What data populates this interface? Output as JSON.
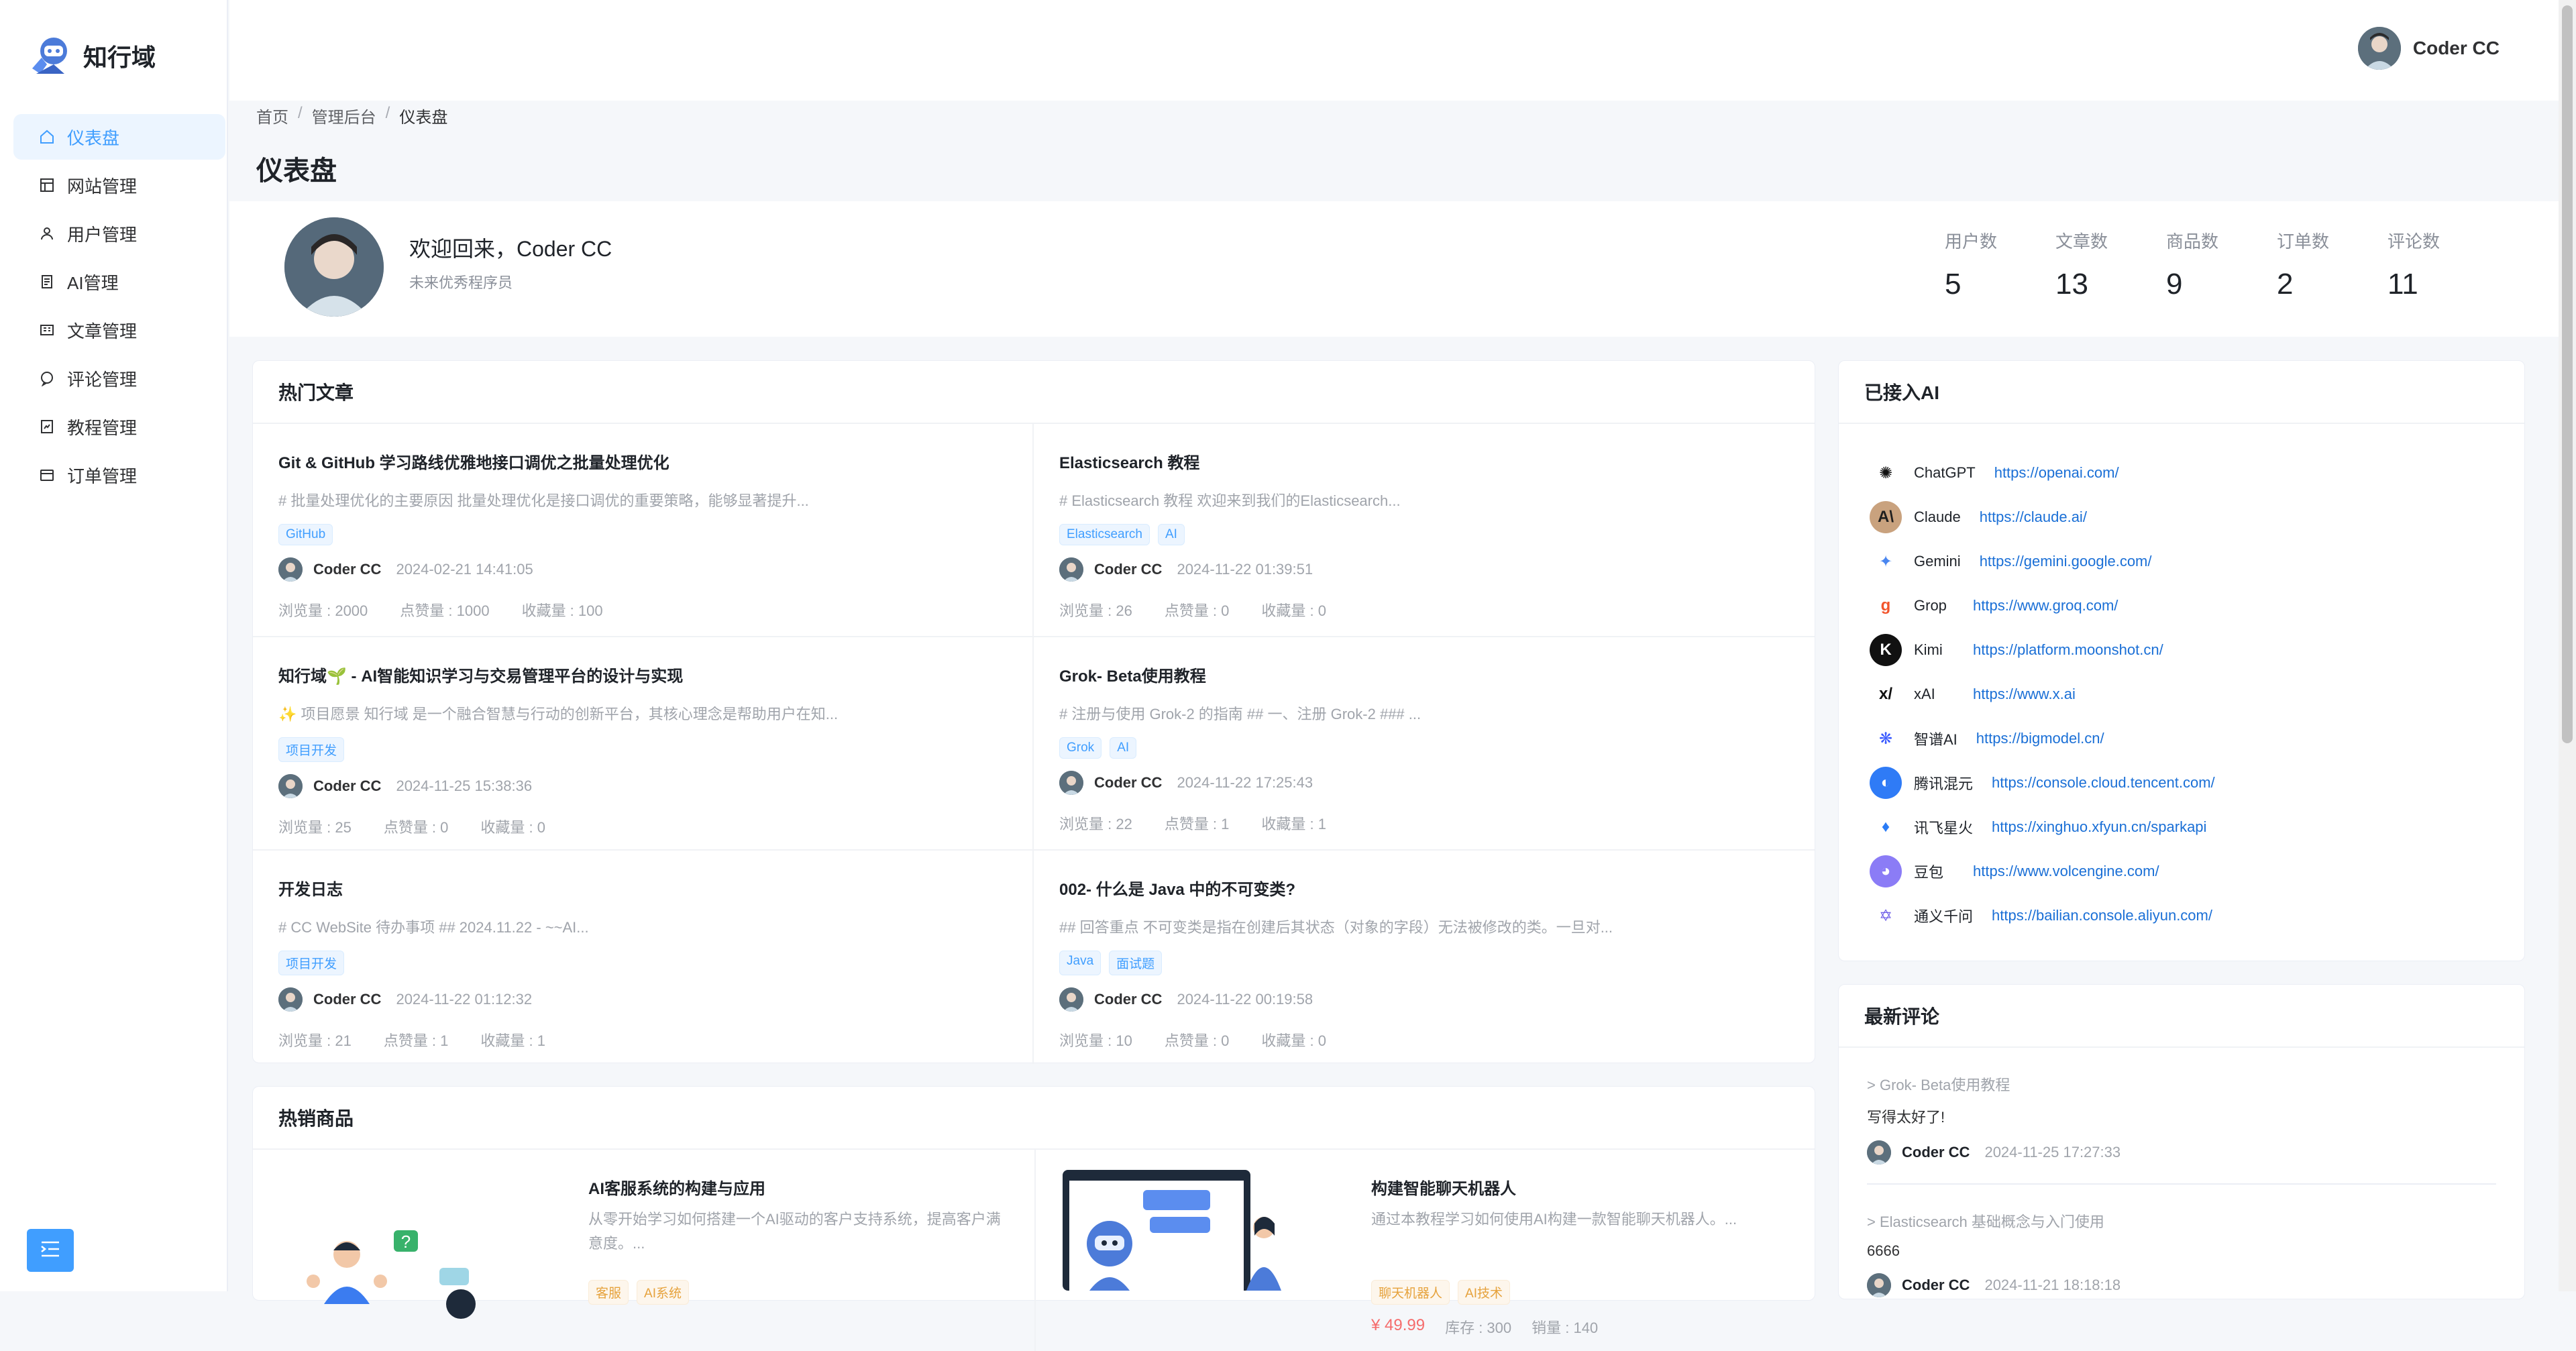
{
  "app": {
    "name": "知行域"
  },
  "sidebar": {
    "items": [
      {
        "label": "仪表盘",
        "icon": "home-icon",
        "active": true
      },
      {
        "label": "网站管理",
        "icon": "grid-icon"
      },
      {
        "label": "用户管理",
        "icon": "user-icon"
      },
      {
        "label": "AI管理",
        "icon": "document-icon"
      },
      {
        "label": "文章管理",
        "icon": "book-icon"
      },
      {
        "label": "评论管理",
        "icon": "chat-icon"
      },
      {
        "label": "教程管理",
        "icon": "tutorial-icon"
      },
      {
        "label": "订单管理",
        "icon": "order-icon"
      }
    ]
  },
  "header": {
    "user_name": "Coder CC"
  },
  "breadcrumb": {
    "items": [
      "首页",
      "管理后台",
      "仪表盘"
    ]
  },
  "page": {
    "title": "仪表盘"
  },
  "welcome": {
    "greeting": "欢迎回来，Coder CC",
    "subtitle": "未来优秀程序员",
    "stats": [
      {
        "label": "用户数",
        "value": "5"
      },
      {
        "label": "文章数",
        "value": "13"
      },
      {
        "label": "商品数",
        "value": "9"
      },
      {
        "label": "订单数",
        "value": "2"
      },
      {
        "label": "评论数",
        "value": "11"
      }
    ]
  },
  "hot_articles": {
    "title": "热门文章",
    "items": [
      {
        "title": "Git & GitHub 学习路线优雅地接口调优之批量处理优化",
        "desc": "# 批量处理优化的主要原因 批量处理优化是接口调优的重要策略，能够显著提升...",
        "tags": [
          "GitHub"
        ],
        "author": "Coder CC",
        "time": "2024-02-21 14:41:05",
        "views": "浏览量 : 2000",
        "likes": "点赞量 : 1000",
        "favs": "收藏量 : 100"
      },
      {
        "title": "Elasticsearch 教程",
        "desc": "# Elasticsearch 教程 欢迎来到我们的Elasticsearch...",
        "tags": [
          "Elasticsearch",
          "AI"
        ],
        "author": "Coder CC",
        "time": "2024-11-22 01:39:51",
        "views": "浏览量 : 26",
        "likes": "点赞量 : 0",
        "favs": "收藏量 : 0"
      },
      {
        "title": "知行域🌱 - AI智能知识学习与交易管理平台的设计与实现",
        "desc": "✨ 项目愿景 知行域 是一个融合智慧与行动的创新平台，其核心理念是帮助用户在知...",
        "tags": [
          "项目开发"
        ],
        "author": "Coder CC",
        "time": "2024-11-25 15:38:36",
        "views": "浏览量 : 25",
        "likes": "点赞量 : 0",
        "favs": "收藏量 : 0"
      },
      {
        "title": "Grok- Beta使用教程",
        "desc": "# 注册与使用 Grok-2 的指南 ## 一、注册 Grok-2 ### ...",
        "tags": [
          "Grok",
          "AI"
        ],
        "author": "Coder CC",
        "time": "2024-11-22 17:25:43",
        "views": "浏览量 : 22",
        "likes": "点赞量 : 1",
        "favs": "收藏量 : 1"
      },
      {
        "title": "开发日志",
        "desc": "# CC WebSite 待办事项 ## 2024.11.22 - ~~AI...",
        "tags": [
          "项目开发"
        ],
        "author": "Coder CC",
        "time": "2024-11-22 01:12:32",
        "views": "浏览量 : 21",
        "likes": "点赞量 : 1",
        "favs": "收藏量 : 1"
      },
      {
        "title": "002- 什么是 Java 中的不可变类?",
        "desc": "## 回答重点 不可变类是指在创建后其状态（对象的字段）无法被修改的类。一旦对...",
        "tags": [
          "Java",
          "面试题"
        ],
        "author": "Coder CC",
        "time": "2024-11-22 00:19:58",
        "views": "浏览量 : 10",
        "likes": "点赞量 : 0",
        "favs": "收藏量 : 0"
      }
    ]
  },
  "hot_goods": {
    "title": "热销商品",
    "items": [
      {
        "title": "AI客服系统的构建与应用",
        "desc": "从零开始学习如何搭建一个AI驱动的客户支持系统，提高客户满意度。...",
        "tags": [
          "客服",
          "AI系统"
        ]
      },
      {
        "title": "构建智能聊天机器人",
        "desc": "通过本教程学习如何使用AI构建一款智能聊天机器人。...",
        "tags": [
          "聊天机器人",
          "AI技术"
        ],
        "price": "¥ 49.99",
        "stock": "库存 : 300",
        "sales": "销量 : 140"
      }
    ]
  },
  "ai_panel": {
    "title": "已接入AI",
    "items": [
      {
        "name": "ChatGPT",
        "url": "https://openai.com/",
        "color": "#ffffff",
        "fg": "#111111",
        "glyph": "✺"
      },
      {
        "name": "Claude",
        "url": "https://claude.ai/",
        "color": "#c9a27e",
        "fg": "#1f1f1f",
        "glyph": "A\\"
      },
      {
        "name": "Gemini",
        "url": "https://gemini.google.com/",
        "color": "#ffffff",
        "fg": "#4a86f0",
        "glyph": "✦"
      },
      {
        "name": "Grop",
        "url": "https://www.groq.com/",
        "color": "#ffffff",
        "fg": "#f2552c",
        "glyph": "g"
      },
      {
        "name": "Kimi",
        "url": "https://platform.moonshot.cn/",
        "color": "#111111",
        "fg": "#ffffff",
        "glyph": "K"
      },
      {
        "name": "xAI",
        "url": "https://www.x.ai",
        "color": "#ffffff",
        "fg": "#111111",
        "glyph": "x/"
      },
      {
        "name": "智谱AI",
        "url": "https://bigmodel.cn/",
        "color": "#ffffff",
        "fg": "#3859ff",
        "glyph": "❋"
      },
      {
        "name": "腾讯混元",
        "url": "https://console.cloud.tencent.com/",
        "color": "#2f7bf6",
        "fg": "#ffffff",
        "glyph": "◐"
      },
      {
        "name": "讯飞星火",
        "url": "https://xinghuo.xfyun.cn/sparkapi",
        "color": "#ffffff",
        "fg": "#2a7cf6",
        "glyph": "♦"
      },
      {
        "name": "豆包",
        "url": "https://www.volcengine.com/",
        "color": "#8b7cf6",
        "fg": "#ffffff",
        "glyph": "◕"
      },
      {
        "name": "通义千问",
        "url": "https://bailian.console.aliyun.com/",
        "color": "#ffffff",
        "fg": "#6c5ce7",
        "glyph": "✡"
      }
    ]
  },
  "comments": {
    "title": "最新评论",
    "items": [
      {
        "ref": "> Grok- Beta使用教程",
        "text": "写得太好了!",
        "author": "Coder CC",
        "time": "2024-11-25 17:27:33"
      },
      {
        "ref": "> Elasticsearch 基础概念与入门使用",
        "text": "6666",
        "author": "Coder CC",
        "time": "2024-11-21 18:18:18"
      }
    ]
  },
  "colors": {
    "primary": "#409eff",
    "bg": "#f5f7fa"
  }
}
